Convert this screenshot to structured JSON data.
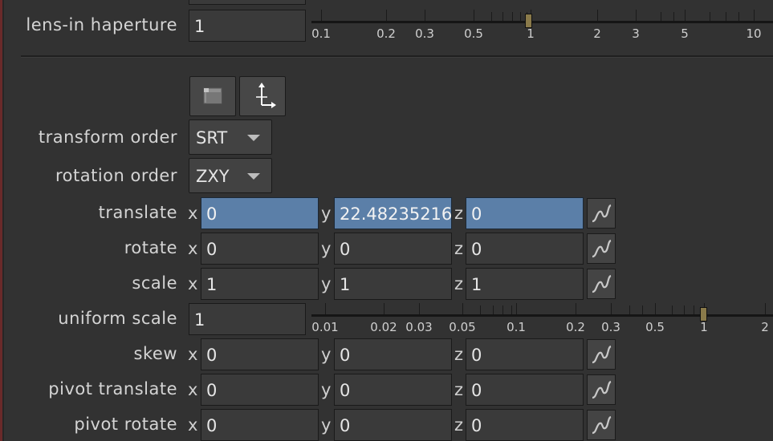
{
  "lens_in_haperture": {
    "label": "lens-in haperture",
    "value": "1",
    "scale_labels": [
      "0.1",
      "0.2",
      "0.3",
      "0.5",
      "1",
      "2",
      "3",
      "5",
      "10"
    ]
  },
  "tool_buttons": [
    {
      "icon": "folder-icon"
    },
    {
      "icon": "axis-gizmo-icon"
    }
  ],
  "transform_order": {
    "label": "transform order",
    "value": "SRT"
  },
  "rotation_order": {
    "label": "rotation order",
    "value": "ZXY"
  },
  "rows": [
    {
      "label": "translate",
      "x": "0",
      "y": "22.48235216",
      "z": "0",
      "selected": true
    },
    {
      "label": "rotate",
      "x": "0",
      "y": "0",
      "z": "0",
      "selected": false
    },
    {
      "label": "scale",
      "x": "1",
      "y": "1",
      "z": "1",
      "selected": false
    },
    {
      "label": "skew",
      "x": "0",
      "y": "0",
      "z": "0",
      "selected": false
    },
    {
      "label": "pivot translate",
      "x": "0",
      "y": "0",
      "z": "0",
      "selected": false
    },
    {
      "label": "pivot rotate",
      "x": "0",
      "y": "0",
      "z": "0",
      "selected": false
    }
  ],
  "axis_labels": {
    "x": "x",
    "y": "y",
    "z": "z"
  },
  "uniform_scale": {
    "label": "uniform scale",
    "value": "1",
    "scale_labels": [
      "0.01",
      "0.02",
      "0.03",
      "0.05",
      "0.1",
      "0.2",
      "0.3",
      "0.5",
      "1",
      "2"
    ]
  },
  "colors": {
    "panel_bg": "#323232",
    "selected_field": "#5b7fa8",
    "field_bg": "#3a3a3a",
    "slider_thumb": "#8a7a4a"
  }
}
